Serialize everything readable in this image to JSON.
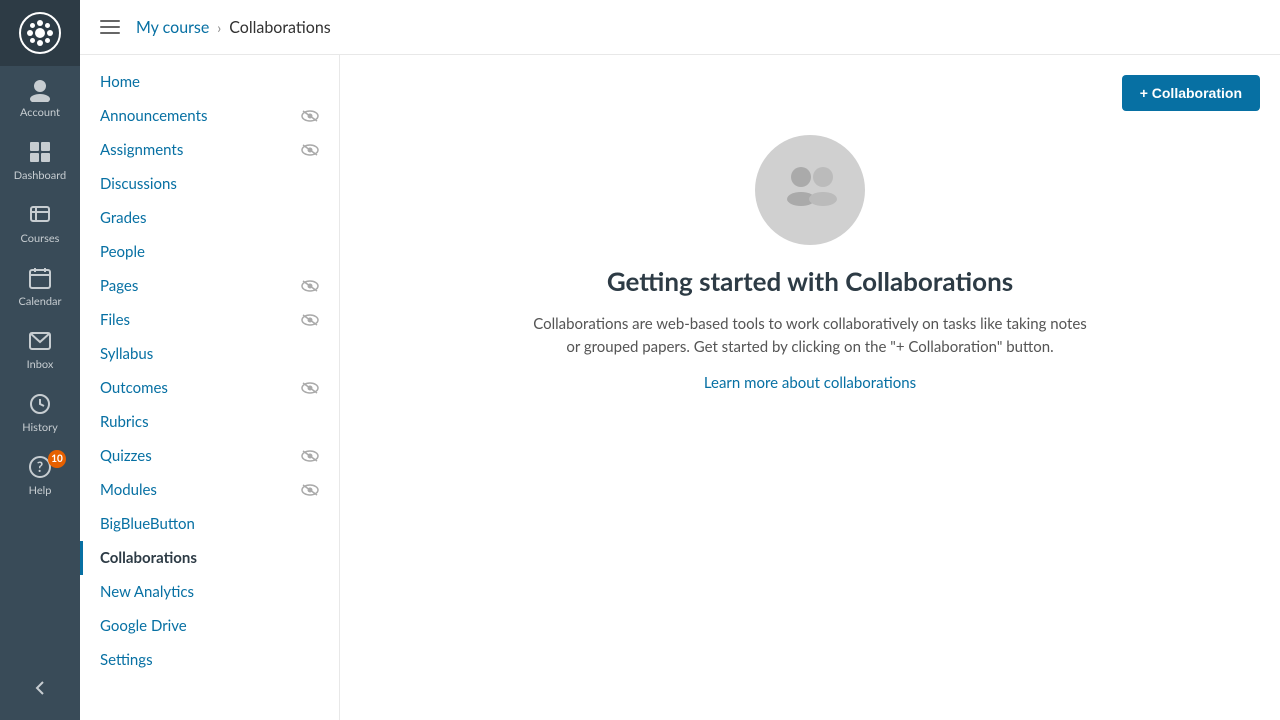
{
  "global_nav": {
    "logo_alt": "Canvas LMS",
    "items": [
      {
        "id": "account",
        "label": "Account",
        "icon": "account-icon"
      },
      {
        "id": "dashboard",
        "label": "Dashboard",
        "icon": "dashboard-icon"
      },
      {
        "id": "courses",
        "label": "Courses",
        "icon": "courses-icon"
      },
      {
        "id": "calendar",
        "label": "Calendar",
        "icon": "calendar-icon"
      },
      {
        "id": "inbox",
        "label": "Inbox",
        "icon": "inbox-icon"
      },
      {
        "id": "history",
        "label": "History",
        "icon": "history-icon"
      },
      {
        "id": "help",
        "label": "Help",
        "icon": "help-icon",
        "badge": "10"
      }
    ],
    "collapse_label": "Collapse navigation"
  },
  "breadcrumb": {
    "parent": "My course",
    "current": "Collaborations",
    "separator": "›"
  },
  "course_nav": {
    "items": [
      {
        "id": "home",
        "label": "Home",
        "active": false,
        "eye": false
      },
      {
        "id": "announcements",
        "label": "Announcements",
        "active": false,
        "eye": true
      },
      {
        "id": "assignments",
        "label": "Assignments",
        "active": false,
        "eye": true
      },
      {
        "id": "discussions",
        "label": "Discussions",
        "active": false,
        "eye": false
      },
      {
        "id": "grades",
        "label": "Grades",
        "active": false,
        "eye": false
      },
      {
        "id": "people",
        "label": "People",
        "active": false,
        "eye": false
      },
      {
        "id": "pages",
        "label": "Pages",
        "active": false,
        "eye": true
      },
      {
        "id": "files",
        "label": "Files",
        "active": false,
        "eye": true
      },
      {
        "id": "syllabus",
        "label": "Syllabus",
        "active": false,
        "eye": false
      },
      {
        "id": "outcomes",
        "label": "Outcomes",
        "active": false,
        "eye": true
      },
      {
        "id": "rubrics",
        "label": "Rubrics",
        "active": false,
        "eye": false
      },
      {
        "id": "quizzes",
        "label": "Quizzes",
        "active": false,
        "eye": true
      },
      {
        "id": "modules",
        "label": "Modules",
        "active": false,
        "eye": true
      },
      {
        "id": "bigbluebutton",
        "label": "BigBlueButton",
        "active": false,
        "eye": false
      },
      {
        "id": "collaborations",
        "label": "Collaborations",
        "active": true,
        "eye": false
      },
      {
        "id": "new-analytics",
        "label": "New Analytics",
        "active": false,
        "eye": false
      },
      {
        "id": "google-drive",
        "label": "Google Drive",
        "active": false,
        "eye": false
      },
      {
        "id": "settings",
        "label": "Settings",
        "active": false,
        "eye": false
      }
    ]
  },
  "main": {
    "add_button_label": "+ Collaboration",
    "empty_state": {
      "title": "Getting started with Collaborations",
      "description": "Collaborations are web-based tools to work collaboratively on tasks like taking notes or grouped papers. Get started by clicking on the \"+ Collaboration\" button.",
      "link_text": "Learn more about collaborations",
      "link_href": "#"
    }
  }
}
